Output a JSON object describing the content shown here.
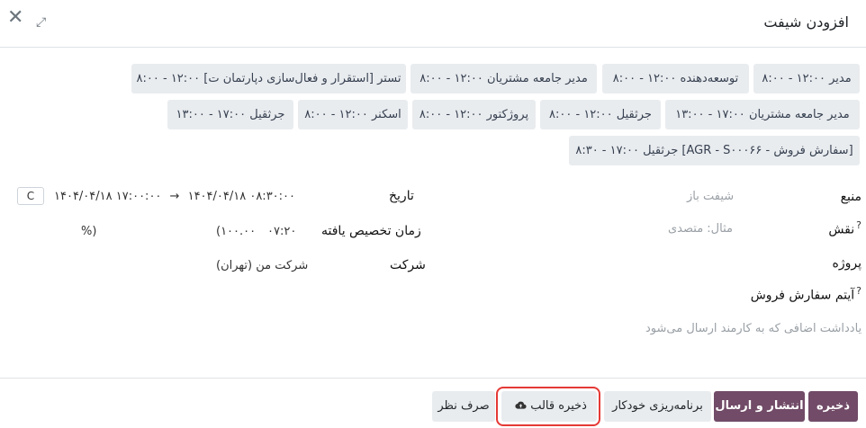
{
  "dialog": {
    "title": "افزودن شیفت"
  },
  "templates": [
    "۸:۰۰ - ۱۲:۰۰ مدیر",
    "۸:۰۰ - ۱۲:۰۰ توسعه‌دهنده",
    "۸:۰۰ - ۱۲:۰۰ مدیر جامعه مشتریان",
    "۸:۰۰ - ۱۲:۰۰ تستر [استقرار و فعال‌سازی دپارتمان ت]",
    "۱۳:۰۰ - ۱۷:۰۰ مدیر جامعه مشتریان",
    "۸:۰۰ - ۱۲:۰۰ جرثقیل",
    "۸:۰۰ - ۱۲:۰۰ پروژکتور",
    "۸:۰۰ - ۱۲:۰۰ اسکنر",
    "۱۳:۰۰ - ۱۷:۰۰ جرثقیل",
    "۸:۳۰ - ۱۷:۰۰ جرثقیل [AGR - S۰۰۰۶۶ - سفارش فروش]"
  ],
  "form": {
    "source_label": "منبع",
    "source_placeholder": "شیفت باز",
    "role_label": "نقش",
    "role_help": "?",
    "role_placeholder": "مثال: متصدی",
    "project_label": "پروژه",
    "sale_item_label": "آیتم سفارش فروش",
    "sale_item_help": "?",
    "note_placeholder": "یادداشت اضافی که به کارمند ارسال می‌شود",
    "date_label": "تاریخ",
    "date_start": "۱۴۰۴/۰۴/۱۸ ۰۸:۳۰:۰۰",
    "date_arrow": "→",
    "date_end": "۱۴۰۴/۰۴/۱۸ ۱۷:۰۰:۰۰",
    "refresh_icon": "C",
    "allocated_label": "زمان تخصیص یافته",
    "allocated_hours": "۰۷:۲۰",
    "allocated_percent": "(۱۰۰.۰۰",
    "allocated_percent_sign": "%)",
    "company_label": "شرکت",
    "company_value": "شرکت من (تهران)"
  },
  "footer": {
    "save": "ذخیره",
    "publish": "انتشار و ارسال",
    "auto_plan": "برنامه‌ریزی خودکار",
    "save_template": "ذخیره قالب",
    "discard": "صرف نظر"
  },
  "colors": {
    "primary": "#714b67",
    "secondary": "#e9ecef",
    "highlight": "#e53935"
  }
}
